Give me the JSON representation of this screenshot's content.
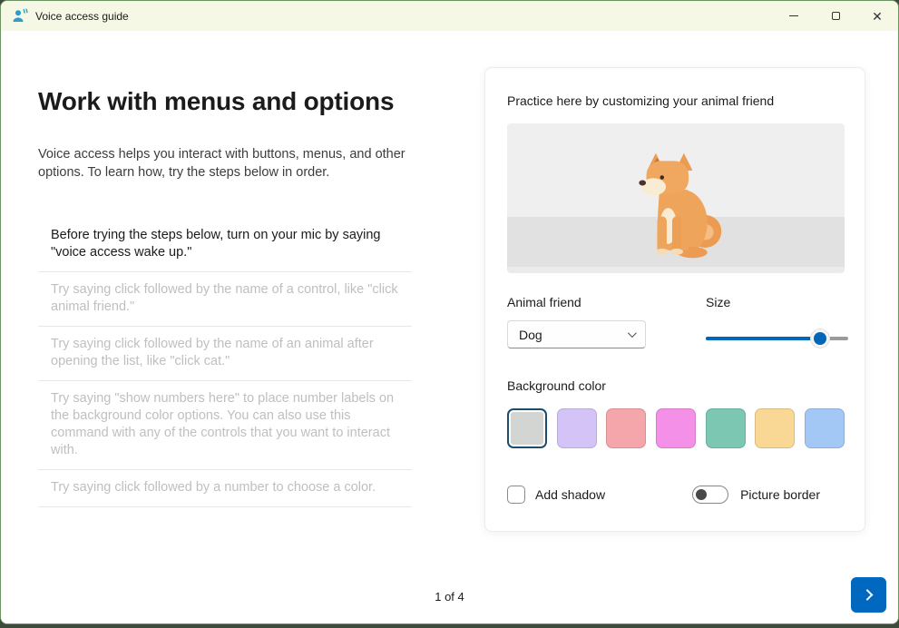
{
  "window": {
    "title": "Voice access guide",
    "controls": {
      "minimize": "minimize",
      "maximize": "maximize",
      "close": "✕"
    }
  },
  "main": {
    "heading": "Work with menus and options",
    "description": "Voice access helps you interact with buttons, menus, and other options. To learn how, try the steps below in order.",
    "steps": [
      {
        "text": "Before trying the steps below, turn on your mic by saying \"voice access wake up.\"",
        "active": true
      },
      {
        "text": "Try saying click followed by the name of a control, like \"click animal friend.\"",
        "active": false
      },
      {
        "text": "Try saying click followed by the name of an animal after opening the list, like \"click cat.\"",
        "active": false
      },
      {
        "text": "Try saying \"show numbers here\" to place number labels on the background color options. You can also use this command with any of the controls that you want to interact with.",
        "active": false
      },
      {
        "text": "Try saying click followed by a number to choose a color.",
        "active": false
      }
    ]
  },
  "practice": {
    "title": "Practice here by customizing your animal friend",
    "animal": {
      "label": "Animal friend",
      "value": "Dog"
    },
    "size": {
      "label": "Size",
      "percent": 80
    },
    "background": {
      "label": "Background color",
      "swatches": [
        {
          "name": "gray",
          "color": "#d2d5d2",
          "selected": true
        },
        {
          "name": "lavender",
          "color": "#d4c3f6",
          "selected": false
        },
        {
          "name": "salmon",
          "color": "#f5a6aa",
          "selected": false
        },
        {
          "name": "magenta",
          "color": "#f590e8",
          "selected": false
        },
        {
          "name": "teal",
          "color": "#7cc7b2",
          "selected": false
        },
        {
          "name": "peach",
          "color": "#f9d795",
          "selected": false
        },
        {
          "name": "blue",
          "color": "#a4c8f5",
          "selected": false
        }
      ]
    },
    "shadow": {
      "label": "Add shadow",
      "checked": false
    },
    "border": {
      "label": "Picture border",
      "on": false
    }
  },
  "footer": {
    "page_indicator": "1 of 4"
  },
  "colors": {
    "accent": "#0067b8",
    "titlebar_bg": "#f4f8e4",
    "selected_swatch_border": "#1e4e6e",
    "next_button": "#0069bf"
  }
}
